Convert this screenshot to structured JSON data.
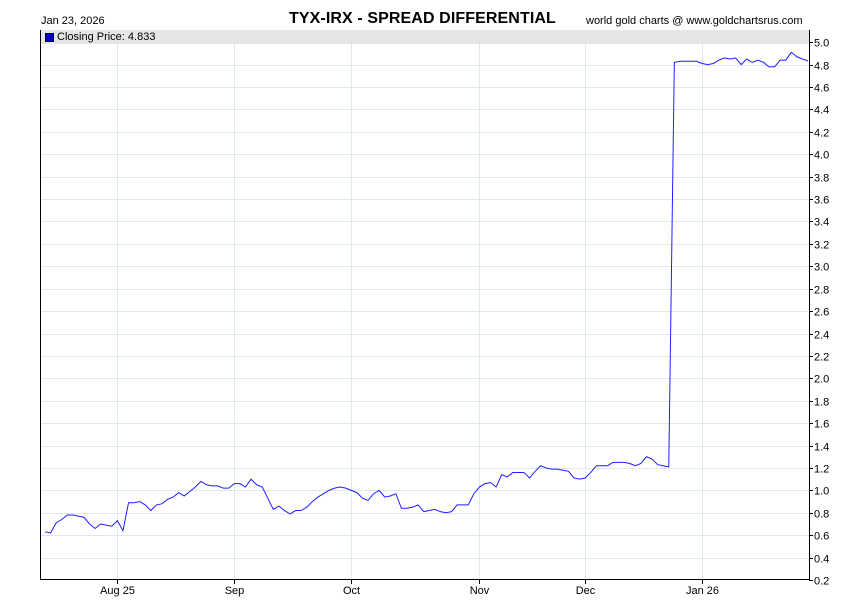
{
  "header": {
    "date": "Jan 23, 2026",
    "title": "TYX-IRX  -  SPREAD DIFFERENTIAL",
    "credit": "world gold charts @ www.goldchartsrus.com"
  },
  "legend": {
    "label": "Closing Price: 4.833"
  },
  "colors": {
    "line": "#1f1fff",
    "grid": "#dfe8ee",
    "legend_bg": "#e6e6e6",
    "swatch": "#0000cc"
  },
  "chart_data": {
    "type": "line",
    "title": "TYX-IRX  -  SPREAD DIFFERENTIAL",
    "xlabel": "",
    "ylabel": "",
    "y_axis_side": "right",
    "ylim": [
      0.2,
      5.1
    ],
    "y_ticks": [
      0.2,
      0.4,
      0.6,
      0.8,
      1.0,
      1.2,
      1.4,
      1.6,
      1.8,
      2.0,
      2.2,
      2.4,
      2.6,
      2.8,
      3.0,
      3.2,
      3.4,
      3.6,
      3.8,
      4.0,
      4.2,
      4.4,
      4.6,
      4.8,
      5.0
    ],
    "x_ticks": [
      {
        "label": "Aug 25",
        "index": 13
      },
      {
        "label": "Sep",
        "index": 34
      },
      {
        "label": "Oct",
        "index": 55
      },
      {
        "label": "Nov",
        "index": 78
      },
      {
        "label": "Dec",
        "index": 97
      },
      {
        "label": "Jan 26",
        "index": 118
      }
    ],
    "grid": true,
    "legend_position": "top-left",
    "series": [
      {
        "name": "Closing Price",
        "values": [
          0.63,
          0.62,
          0.71,
          0.74,
          0.78,
          0.78,
          0.77,
          0.76,
          0.7,
          0.66,
          0.7,
          0.69,
          0.68,
          0.73,
          0.64,
          0.89,
          0.89,
          0.9,
          0.87,
          0.82,
          0.87,
          0.88,
          0.92,
          0.94,
          0.98,
          0.95,
          0.99,
          1.03,
          1.08,
          1.05,
          1.04,
          1.04,
          1.02,
          1.02,
          1.06,
          1.06,
          1.03,
          1.1,
          1.05,
          1.03,
          0.93,
          0.83,
          0.86,
          0.82,
          0.79,
          0.82,
          0.82,
          0.85,
          0.9,
          0.94,
          0.97,
          1.0,
          1.02,
          1.03,
          1.02,
          1.0,
          0.98,
          0.93,
          0.91,
          0.97,
          1.0,
          0.94,
          0.95,
          0.97,
          0.84,
          0.84,
          0.85,
          0.87,
          0.81,
          0.82,
          0.83,
          0.81,
          0.8,
          0.81,
          0.87,
          0.87,
          0.87,
          0.97,
          1.03,
          1.06,
          1.07,
          1.03,
          1.14,
          1.12,
          1.16,
          1.16,
          1.16,
          1.11,
          1.17,
          1.22,
          1.2,
          1.19,
          1.19,
          1.18,
          1.17,
          1.11,
          1.1,
          1.11,
          1.16,
          1.22,
          1.22,
          1.22,
          1.25,
          1.25,
          1.25,
          1.24,
          1.22,
          1.24,
          1.3,
          1.28,
          1.23,
          1.22,
          1.21,
          4.82,
          4.83,
          4.83,
          4.83,
          4.83,
          4.81,
          4.8,
          4.81,
          4.84,
          4.86,
          4.85,
          4.86,
          4.8,
          4.85,
          4.82,
          4.84,
          4.82,
          4.78,
          4.78,
          4.84,
          4.84,
          4.91,
          4.87,
          4.85,
          4.833
        ]
      }
    ]
  }
}
